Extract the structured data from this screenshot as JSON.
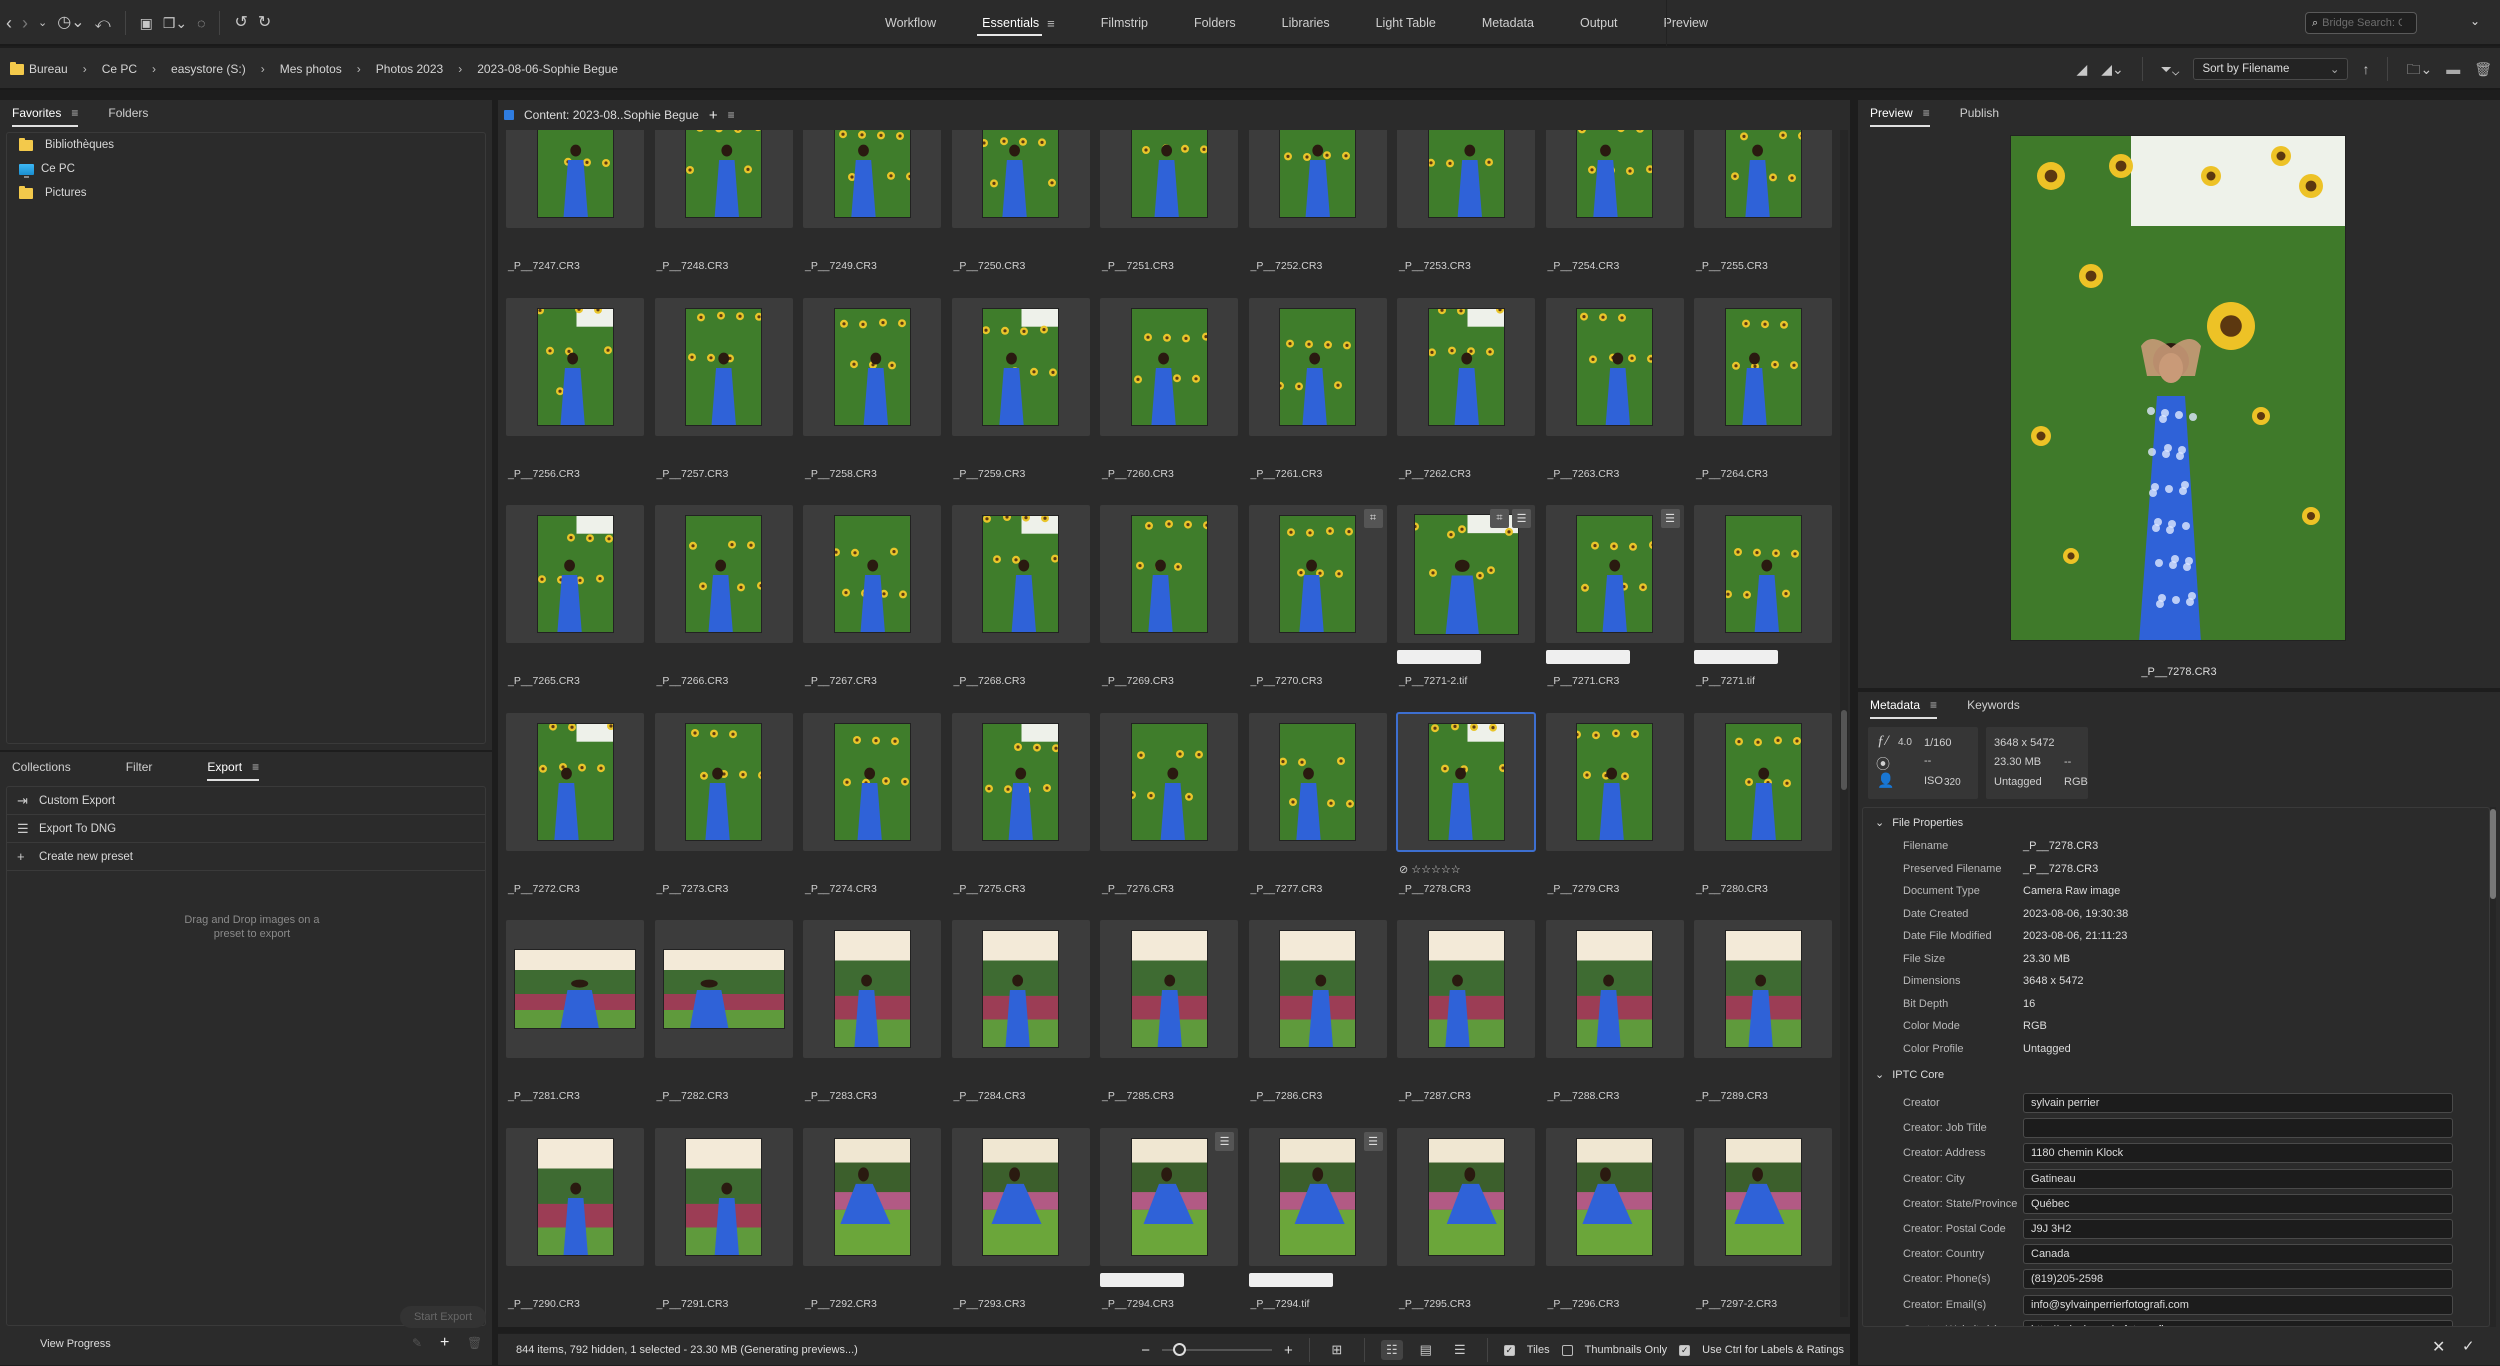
{
  "toolbar": {
    "icons": [
      "back-arrow",
      "forward-arrow",
      "recent-dropdown",
      "history-clock",
      "boomerang",
      "camera-import",
      "copy-dropdown",
      "refine",
      "rotate-ccw",
      "rotate-cw"
    ]
  },
  "workspaces": {
    "tabs": [
      {
        "label": "Workflow",
        "active": false
      },
      {
        "label": "Essentials",
        "active": true
      },
      {
        "label": "Filmstrip",
        "active": false
      },
      {
        "label": "Folders",
        "active": false
      },
      {
        "label": "Libraries",
        "active": false
      },
      {
        "label": "Light Table",
        "active": false
      },
      {
        "label": "Metadata",
        "active": false
      },
      {
        "label": "Output",
        "active": false
      },
      {
        "label": "Preview",
        "active": false
      }
    ],
    "menu_icon": "≡"
  },
  "search": {
    "placeholder": "Bridge Search: Current"
  },
  "breadcrumb": [
    "Bureau",
    "Ce PC",
    "easystore (S:)",
    "Mes photos",
    "Photos 2023",
    "2023-08-06-Sophie Begue"
  ],
  "pathbar_right": {
    "sort_label": "Sort by Filename"
  },
  "favorites_panel": {
    "tabs": [
      {
        "label": "Favorites",
        "active": true
      },
      {
        "label": "Folders",
        "active": false
      }
    ],
    "items": [
      {
        "label": "Bibliothèques",
        "icon": "folder"
      },
      {
        "label": "Ce PC",
        "icon": "pc"
      },
      {
        "label": "Pictures",
        "icon": "folder"
      }
    ]
  },
  "export_panel": {
    "tabs": [
      {
        "label": "Collections",
        "active": false
      },
      {
        "label": "Filter",
        "active": false
      },
      {
        "label": "Export",
        "active": true
      }
    ],
    "items": [
      {
        "label": "Custom Export",
        "icon": "export-icon"
      },
      {
        "label": "Export To DNG",
        "icon": "list-icon"
      },
      {
        "label": "Create new preset",
        "icon": "plus-icon"
      }
    ],
    "hint": "Drag and Drop images on a preset to export",
    "start_export": "Start Export",
    "view_progress": "View Progress"
  },
  "content": {
    "title": "Content: 2023-08..Sophie Begue",
    "items": [
      {
        "name": "_P__7247.CR3",
        "scene": "sunflower",
        "orient": "portrait"
      },
      {
        "name": "_P__7248.CR3",
        "scene": "sunflower",
        "orient": "portrait"
      },
      {
        "name": "_P__7249.CR3",
        "scene": "sunflower",
        "orient": "portrait"
      },
      {
        "name": "_P__7250.CR3",
        "scene": "sunflower",
        "orient": "portrait"
      },
      {
        "name": "_P__7251.CR3",
        "scene": "sunflower",
        "orient": "portrait"
      },
      {
        "name": "_P__7252.CR3",
        "scene": "sunflower",
        "orient": "portrait"
      },
      {
        "name": "_P__7253.CR3",
        "scene": "sunflower",
        "orient": "portrait"
      },
      {
        "name": "_P__7254.CR3",
        "scene": "sunflower",
        "orient": "portrait"
      },
      {
        "name": "_P__7255.CR3",
        "scene": "sunflower",
        "orient": "portrait"
      },
      {
        "name": "_P__7256.CR3",
        "scene": "sunflower",
        "orient": "portrait"
      },
      {
        "name": "_P__7257.CR3",
        "scene": "sunflower",
        "orient": "portrait"
      },
      {
        "name": "_P__7258.CR3",
        "scene": "sunflower",
        "orient": "portrait"
      },
      {
        "name": "_P__7259.CR3",
        "scene": "sunflower",
        "orient": "portrait"
      },
      {
        "name": "_P__7260.CR3",
        "scene": "sunflower",
        "orient": "portrait"
      },
      {
        "name": "_P__7261.CR3",
        "scene": "sunflower",
        "orient": "portrait"
      },
      {
        "name": "_P__7262.CR3",
        "scene": "sunflower",
        "orient": "portrait"
      },
      {
        "name": "_P__7263.CR3",
        "scene": "sunflower",
        "orient": "portrait"
      },
      {
        "name": "_P__7264.CR3",
        "scene": "sunflower",
        "orient": "portrait"
      },
      {
        "name": "_P__7265.CR3",
        "scene": "sunflower",
        "orient": "portrait"
      },
      {
        "name": "_P__7266.CR3",
        "scene": "sunflower",
        "orient": "portrait"
      },
      {
        "name": "_P__7267.CR3",
        "scene": "sunflower",
        "orient": "portrait"
      },
      {
        "name": "_P__7268.CR3",
        "scene": "sunflower",
        "orient": "portrait"
      },
      {
        "name": "_P__7269.CR3",
        "scene": "sunflower",
        "orient": "portrait"
      },
      {
        "name": "_P__7270.CR3",
        "scene": "sunflower",
        "orient": "portrait",
        "badges": [
          "crop"
        ]
      },
      {
        "name": "_P__7271-2.tif",
        "scene": "sunflower",
        "orient": "wide",
        "badges": [
          "crop",
          "adjust"
        ],
        "label": true
      },
      {
        "name": "_P__7271.CR3",
        "scene": "sunflower",
        "orient": "portrait",
        "badges": [
          "adjust"
        ],
        "label": true
      },
      {
        "name": "_P__7271.tif",
        "scene": "sunflower",
        "orient": "portrait",
        "label": true
      },
      {
        "name": "_P__7272.CR3",
        "scene": "sunflower",
        "orient": "portrait"
      },
      {
        "name": "_P__7273.CR3",
        "scene": "sunflower",
        "orient": "portrait"
      },
      {
        "name": "_P__7274.CR3",
        "scene": "sunflower",
        "orient": "portrait"
      },
      {
        "name": "_P__7275.CR3",
        "scene": "sunflower",
        "orient": "portrait"
      },
      {
        "name": "_P__7276.CR3",
        "scene": "sunflower",
        "orient": "portrait"
      },
      {
        "name": "_P__7277.CR3",
        "scene": "sunflower",
        "orient": "portrait"
      },
      {
        "name": "_P__7278.CR3",
        "scene": "sunflower",
        "orient": "portrait",
        "selected": true,
        "rating": 0
      },
      {
        "name": "_P__7279.CR3",
        "scene": "sunflower",
        "orient": "portrait"
      },
      {
        "name": "_P__7280.CR3",
        "scene": "sunflower",
        "orient": "portrait"
      },
      {
        "name": "_P__7281.CR3",
        "scene": "garden",
        "orient": "landscape"
      },
      {
        "name": "_P__7282.CR3",
        "scene": "garden",
        "orient": "landscape"
      },
      {
        "name": "_P__7283.CR3",
        "scene": "garden",
        "orient": "portrait"
      },
      {
        "name": "_P__7284.CR3",
        "scene": "garden",
        "orient": "portrait"
      },
      {
        "name": "_P__7285.CR3",
        "scene": "garden",
        "orient": "portrait"
      },
      {
        "name": "_P__7286.CR3",
        "scene": "garden",
        "orient": "portrait"
      },
      {
        "name": "_P__7287.CR3",
        "scene": "garden",
        "orient": "portrait"
      },
      {
        "name": "_P__7288.CR3",
        "scene": "garden",
        "orient": "portrait"
      },
      {
        "name": "_P__7289.CR3",
        "scene": "garden",
        "orient": "portrait"
      },
      {
        "name": "_P__7290.CR3",
        "scene": "garden",
        "orient": "portrait"
      },
      {
        "name": "_P__7291.CR3",
        "scene": "garden",
        "orient": "portrait"
      },
      {
        "name": "_P__7292.CR3",
        "scene": "grass",
        "orient": "portrait"
      },
      {
        "name": "_P__7293.CR3",
        "scene": "grass",
        "orient": "portrait"
      },
      {
        "name": "_P__7294.CR3",
        "scene": "grass",
        "orient": "portrait",
        "badges": [
          "adjust"
        ],
        "label": true
      },
      {
        "name": "_P__7294.tif",
        "scene": "grass",
        "orient": "portrait",
        "badges": [
          "adjust"
        ],
        "label": true
      },
      {
        "name": "_P__7295.CR3",
        "scene": "grass",
        "orient": "portrait"
      },
      {
        "name": "_P__7296.CR3",
        "scene": "grass",
        "orient": "portrait"
      },
      {
        "name": "_P__7297-2.CR3",
        "scene": "grass",
        "orient": "portrait"
      }
    ],
    "status": "844 items, 792 hidden, 1 selected - 23.30 MB (Generating previews...)",
    "thumb_size_fraction": 0.1,
    "view_options": {
      "tiles": true,
      "thumbnails_only": false,
      "use_ctrl": true
    },
    "labels": {
      "tiles": "Tiles",
      "thumbnails_only": "Thumbnails Only",
      "use_ctrl": "Use Ctrl for Labels & Ratings"
    }
  },
  "preview_panel": {
    "tabs": [
      {
        "label": "Preview",
        "active": true
      },
      {
        "label": "Publish",
        "active": false
      }
    ],
    "caption": "_P__7278.CR3"
  },
  "metadata_panel": {
    "tabs": [
      {
        "label": "Metadata",
        "active": true
      },
      {
        "label": "Keywords",
        "active": false
      }
    ],
    "summary": {
      "aperture_prefix": "ƒ/",
      "aperture": "4.0",
      "shutter": "1/160",
      "metering": "--",
      "iso_label": "ISO",
      "iso": "320",
      "dimensions": "3648 x 5472",
      "size": "23.30 MB",
      "resolution": "--",
      "profile": "Untagged",
      "mode": "RGB"
    },
    "file_properties": {
      "title": "File Properties",
      "rows": [
        {
          "k": "Filename",
          "v": "_P__7278.CR3"
        },
        {
          "k": "Preserved Filename",
          "v": "_P__7278.CR3"
        },
        {
          "k": "Document Type",
          "v": "Camera Raw image"
        },
        {
          "k": "Date Created",
          "v": "2023-08-06, 19:30:38"
        },
        {
          "k": "Date File Modified",
          "v": "2023-08-06, 21:11:23"
        },
        {
          "k": "File Size",
          "v": "23.30 MB"
        },
        {
          "k": "Dimensions",
          "v": "3648 x 5472"
        },
        {
          "k": "Bit Depth",
          "v": "16"
        },
        {
          "k": "Color Mode",
          "v": "RGB"
        },
        {
          "k": "Color Profile",
          "v": "Untagged"
        }
      ]
    },
    "iptc": {
      "title": "IPTC Core",
      "rows": [
        {
          "k": "Creator",
          "v": "sylvain perrier"
        },
        {
          "k": "Creator: Job Title",
          "v": ""
        },
        {
          "k": "Creator: Address",
          "v": "1180 chemin Klock"
        },
        {
          "k": "Creator: City",
          "v": "Gatineau"
        },
        {
          "k": "Creator: State/Province",
          "v": "Québec"
        },
        {
          "k": "Creator: Postal Code",
          "v": "J9J 3H2"
        },
        {
          "k": "Creator: Country",
          "v": "Canada"
        },
        {
          "k": "Creator: Phone(s)",
          "v": "(819)205-2598"
        },
        {
          "k": "Creator: Email(s)",
          "v": "info@sylvainperrierfotografi.com"
        },
        {
          "k": "Creator: Website(s)",
          "v": "http://sylvainperrierfotografi.com"
        }
      ]
    }
  },
  "colors": {
    "accent": "#2f7de1",
    "selection": "#3d6fd0",
    "bg": "#2b2b2b"
  }
}
